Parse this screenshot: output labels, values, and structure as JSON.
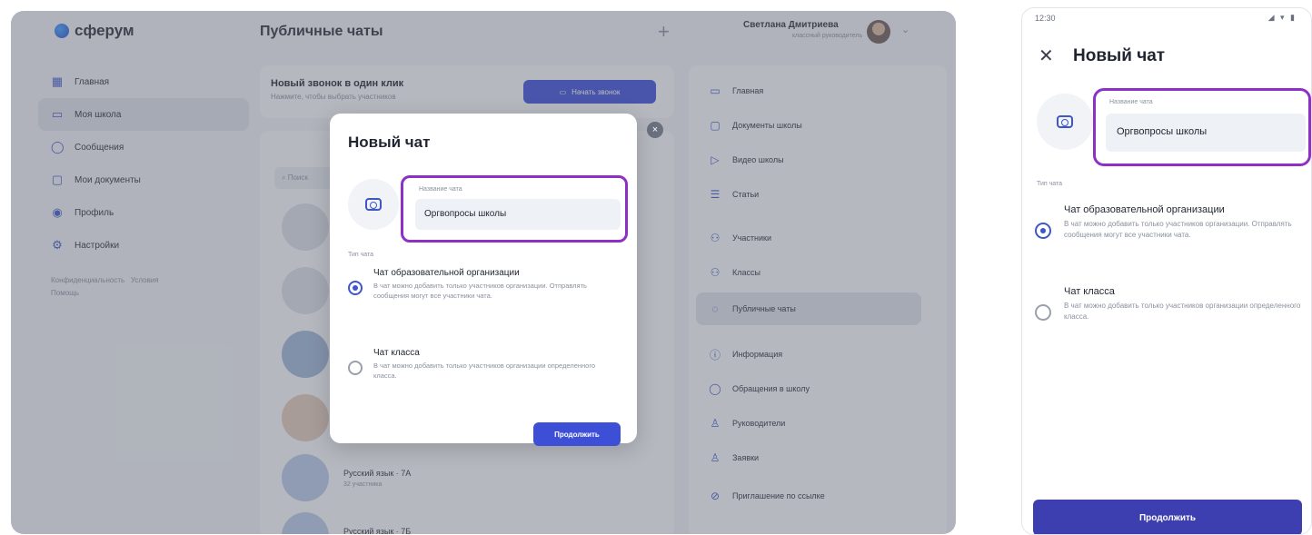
{
  "desktop": {
    "logo_text": "сферум",
    "page_heading": "Публичные чаты",
    "user_name": "Светлана Дмитриева",
    "user_role": "классный руководитель",
    "nav": [
      {
        "label": "Главная",
        "icon": "grid-icon"
      },
      {
        "label": "Моя школа",
        "icon": "school-icon"
      },
      {
        "label": "Сообщения",
        "icon": "chat-icon"
      },
      {
        "label": "Мои документы",
        "icon": "document-icon"
      },
      {
        "label": "Профиль",
        "icon": "profile-icon"
      },
      {
        "label": "Настройки",
        "icon": "settings-icon"
      }
    ],
    "nav_footer": [
      "Конфиденциальность",
      "Условия",
      "Помощь"
    ],
    "banner_title": "Новый звонок в один клик",
    "banner_subtitle": "Нажмите, чтобы выбрать участников",
    "call_button": "Начать звонок",
    "search_placeholder": "Поиск",
    "chats": [
      {
        "name": "Русский язык · 7А",
        "sub": "32 участника"
      },
      {
        "name": "Русский язык · 7Б",
        "sub": ""
      }
    ],
    "right_nav": [
      {
        "label": "Главная",
        "icon": "home-icon"
      },
      {
        "label": "Документы школы",
        "icon": "document-icon"
      },
      {
        "label": "Видео школы",
        "icon": "video-icon"
      },
      {
        "label": "Статьи",
        "icon": "article-icon"
      },
      {
        "label": "Участники",
        "icon": "users-icon"
      },
      {
        "label": "Классы",
        "icon": "classes-icon"
      },
      {
        "label": "Публичные чаты",
        "icon": "public-chat-icon"
      },
      {
        "label": "Информация",
        "icon": "info-icon"
      },
      {
        "label": "Обращения в школу",
        "icon": "message-icon"
      },
      {
        "label": "Руководители",
        "icon": "leaders-icon"
      },
      {
        "label": "Заявки",
        "icon": "requests-icon"
      },
      {
        "label": "Приглашение по ссылке",
        "icon": "link-icon"
      }
    ]
  },
  "modal": {
    "title": "Новый чат",
    "name_label": "Название чата",
    "name_value": "Оргвопросы школы",
    "type_label": "Тип чата",
    "options": [
      {
        "title": "Чат образовательной организации",
        "desc": "В чат можно добавить только участников организации. Отправлять сообщения могут все участники чата.",
        "selected": true
      },
      {
        "title": "Чат класса",
        "desc": "В чат можно добавить только участников организации определенного класса.",
        "selected": false
      }
    ],
    "continue_button": "Продолжить"
  },
  "mobile": {
    "time": "12:30",
    "status_icons": "◢ ▾ ▮",
    "title": "Новый чат",
    "name_label": "Название чата",
    "name_value": "Оргвопросы школы",
    "type_label": "Тип чата",
    "options": [
      {
        "title": "Чат образовательной организации",
        "desc": "В чат можно добавить только участников организации. Отправлять сообщения могут все участники чата.",
        "selected": true
      },
      {
        "title": "Чат класса",
        "desc": "В чат можно добавить только участников организации определенного класса.",
        "selected": false
      }
    ],
    "continue_button": "Продолжить"
  },
  "colors": {
    "accent": "#3d4fd6",
    "highlight": "#8e2fc6",
    "overlay": "#5a606e"
  }
}
